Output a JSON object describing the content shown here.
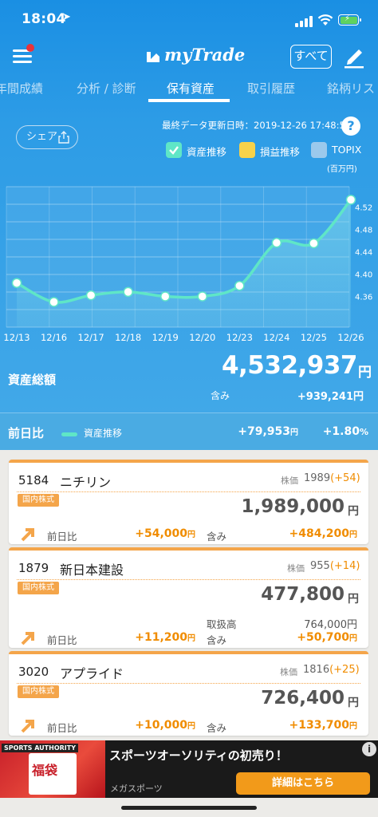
{
  "status": {
    "time": "18:04"
  },
  "nav": {
    "logo": "myTrade",
    "all_label": "すべて"
  },
  "tabs": [
    {
      "label": "年間成績"
    },
    {
      "label": "分析 / 診断"
    },
    {
      "label": "保有資産",
      "active": true
    },
    {
      "label": "取引履歴"
    },
    {
      "label": "銘柄リスト"
    }
  ],
  "summary": {
    "share_label": "シェア",
    "updated_label": "最終データ更新日時：2019-12-26 17:48:55",
    "legend": [
      {
        "label": "資産推移",
        "color": "#5fe6c7"
      },
      {
        "label": "損益推移",
        "color": "#f7d24a"
      },
      {
        "label": "TOPIX",
        "color": "#9bc9ec"
      }
    ],
    "unit": "(百万円)",
    "total_label": "資産総額",
    "total_value": "4,532,937",
    "yen": "円",
    "gain_label": "含み",
    "gain_value": "+939,241円"
  },
  "chart_data": {
    "type": "line",
    "x": [
      "12/13",
      "12/16",
      "12/17",
      "12/18",
      "12/19",
      "12/20",
      "12/23",
      "12/24",
      "12/25",
      "12/26"
    ],
    "series": [
      {
        "name": "資産推移",
        "values": [
          4.384,
          4.35,
          4.362,
          4.368,
          4.36,
          4.36,
          4.379,
          4.456,
          4.455,
          4.533
        ]
      }
    ],
    "y_ticks": [
      "4.36",
      "4.40",
      "4.44",
      "4.48",
      "4.52"
    ],
    "ylim": [
      4.325,
      4.545
    ],
    "ylabel": "(百万円)",
    "grid": true
  },
  "daily": {
    "label": "前日比",
    "series_label": "資産推移",
    "change": "+79,953",
    "change_yen": "円",
    "pct": "+1.80",
    "pct_unit": "%"
  },
  "holdings": [
    {
      "code": "5184",
      "name": "ニチリン",
      "price_label": "株価",
      "price": "1989",
      "price_chg": "(+54)",
      "tag": "国内株式",
      "amount": "1,989,000",
      "day_label": "前日比",
      "day_value": "+54,000",
      "gain_label": "含み",
      "gain_value": "+484,200"
    },
    {
      "code": "1879",
      "name": "新日本建設",
      "price_label": "株価",
      "price": "955",
      "price_chg": "(+14)",
      "tag": "国内株式",
      "amount": "477,800",
      "cost_label": "取扱高",
      "cost_value": "764,000円",
      "day_label": "前日比",
      "day_value": "+11,200",
      "gain_label": "含み",
      "gain_value": "+50,700"
    },
    {
      "code": "3020",
      "name": "アプライド",
      "price_label": "株価",
      "price": "1816",
      "price_chg": "(+25)",
      "tag": "国内株式",
      "amount": "726,400",
      "day_label": "前日比",
      "day_value": "+10,000",
      "gain_label": "含み",
      "gain_value": "+133,700"
    }
  ],
  "yen_small": "円",
  "ad": {
    "title": "スポーツオーソリティの初売り！",
    "advertiser": "メガスポーツ",
    "cta": "詳細はこちら",
    "img_label": "福袋",
    "brand": "SPORTS AUTHORITY"
  }
}
